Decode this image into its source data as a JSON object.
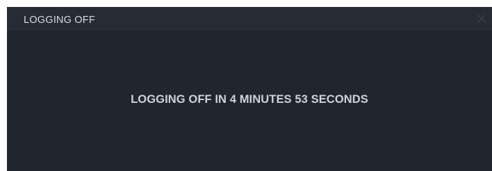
{
  "dialog": {
    "title": "LOGGING OFF",
    "message": "LOGGING OFF IN 4 MINUTES 53 SECONDS",
    "close_icon": "close-icon"
  },
  "colors": {
    "background": "#20262f",
    "titlebar": "#262c35",
    "text": "#cdd3da",
    "close_icon": "#3a414b"
  }
}
